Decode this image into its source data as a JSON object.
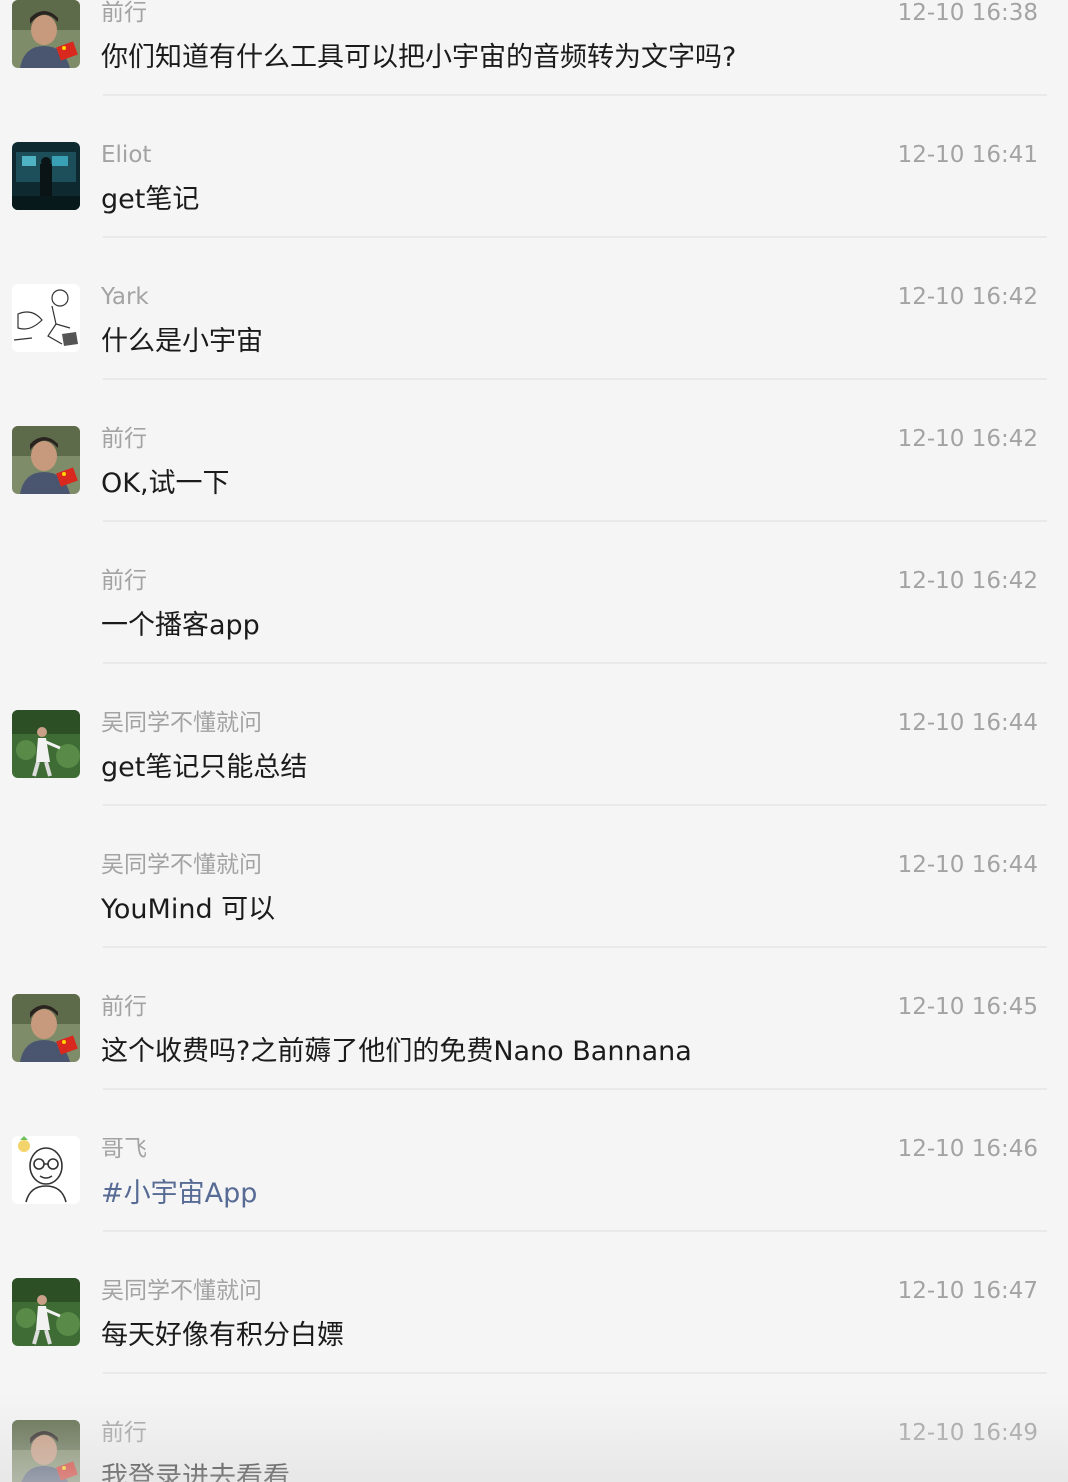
{
  "messages": [
    {
      "sender": "前行",
      "time": "12-10 16:38",
      "text": "你们知道有什么工具可以把小宇宙的音频转为文字吗?",
      "avatar": "qianxing-avatar"
    },
    {
      "sender": "Eliot",
      "time": "12-10 16:41",
      "text": "get笔记",
      "avatar": "eliot-avatar"
    },
    {
      "sender": "Yark",
      "time": "12-10 16:42",
      "text": "什么是小宇宙",
      "avatar": "yark-avatar"
    },
    {
      "sender": "前行",
      "time": "12-10 16:42",
      "text": "OK,试一下",
      "avatar": "qianxing-avatar"
    },
    {
      "sender": "前行",
      "time": "12-10 16:42",
      "text": "一个播客app",
      "avatar": ""
    },
    {
      "sender": "吴同学不懂就问",
      "time": "12-10 16:44",
      "text": "get笔记只能总结",
      "avatar": "wu-avatar"
    },
    {
      "sender": "吴同学不懂就问",
      "time": "12-10 16:44",
      "text": "YouMind 可以",
      "avatar": ""
    },
    {
      "sender": "前行",
      "time": "12-10 16:45",
      "text": "这个收费吗?之前薅了他们的免费Nano Bannana",
      "avatar": "qianxing-avatar"
    },
    {
      "sender": "哥飞",
      "time": "12-10 16:46",
      "text": "#小宇宙App",
      "avatar": "gefei-avatar",
      "is_link": true
    },
    {
      "sender": "吴同学不懂就问",
      "time": "12-10 16:47",
      "text": "每天好像有积分白嫖",
      "avatar": "wu-avatar"
    },
    {
      "sender": "前行",
      "time": "12-10 16:49",
      "text": "我登录进去看看",
      "avatar": "qianxing-avatar"
    }
  ],
  "colors": {
    "background": "#f5f5f5",
    "meta_text": "#a3a3a3",
    "body_text": "#1b1b1b",
    "link_text": "#576b95",
    "divider": "#e9e9e9"
  }
}
